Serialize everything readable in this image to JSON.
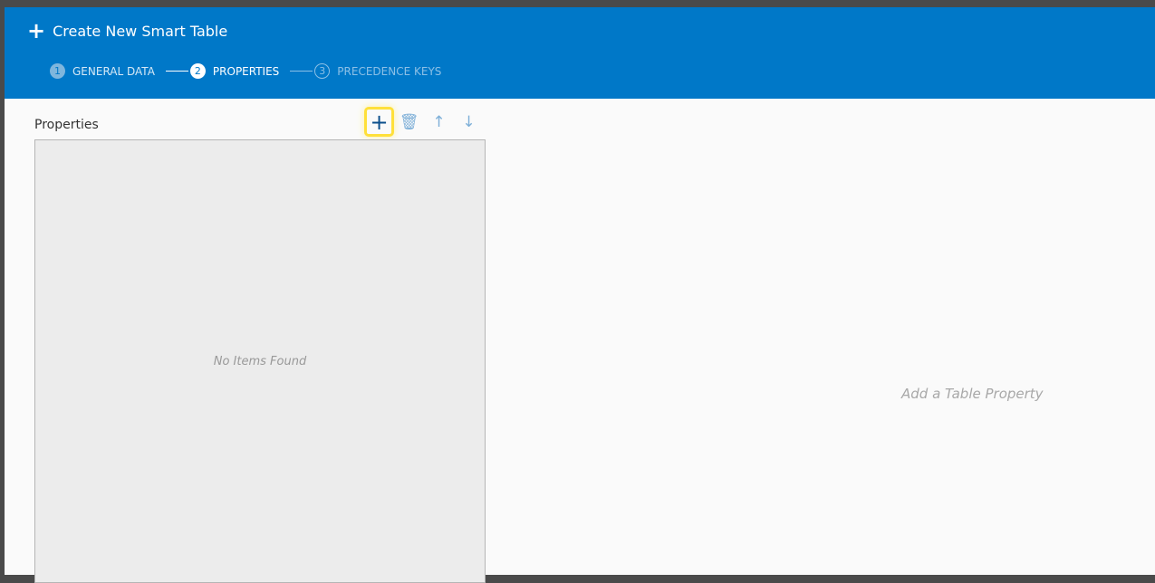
{
  "header": {
    "title": "Create New Smart Table"
  },
  "steps": [
    {
      "number": "1",
      "label": "GENERAL DATA",
      "state": "done"
    },
    {
      "number": "2",
      "label": "PROPERTIES",
      "state": "active"
    },
    {
      "number": "3",
      "label": "PRECEDENCE KEYS",
      "state": "future"
    }
  ],
  "properties": {
    "title": "Properties",
    "empty_text": "No Items Found"
  },
  "detail": {
    "hint": "Add a Table Property"
  },
  "colors": {
    "header": "#0078c8",
    "highlight": "#ffe03a"
  }
}
